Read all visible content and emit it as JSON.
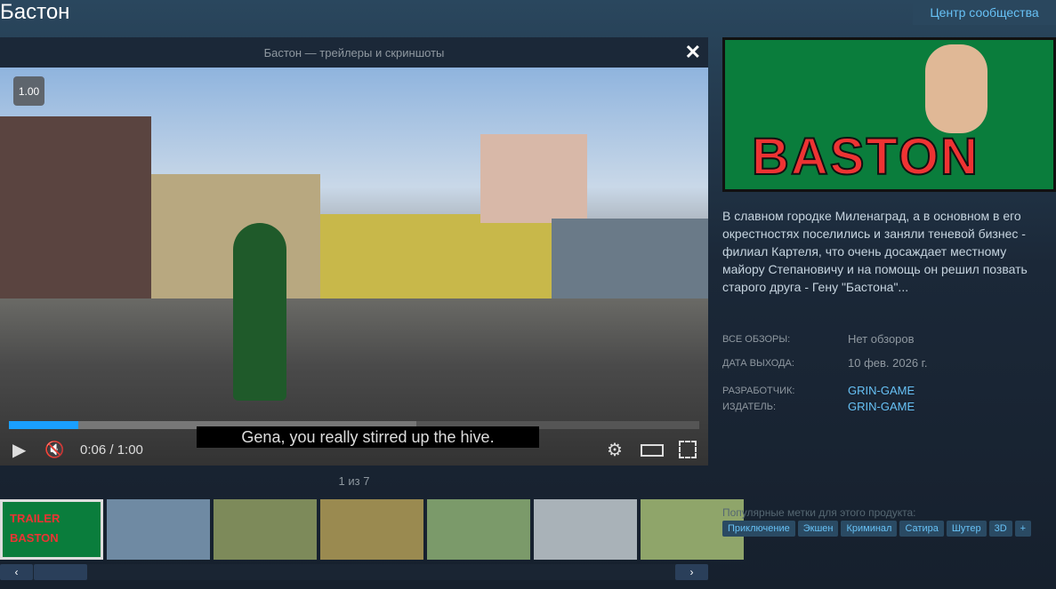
{
  "header": {
    "title": "Бастон",
    "community_button": "Центр сообщества"
  },
  "player": {
    "title": "Бастон — трейлеры и скриншоты",
    "speed": "1.00",
    "subtitle": "Gena, you really stirred up the hive.",
    "time": "0:06 / 1:00",
    "progress_percent": 10,
    "buffered_percent": 59,
    "counter": "1 из 7"
  },
  "capsule": {
    "logo_text": "BASTON"
  },
  "thumbs": [
    {
      "label": "TRAILER BASTON",
      "color": "#0a7d3c"
    },
    {
      "color": "#6f8aa3"
    },
    {
      "color": "#7d8a5a"
    },
    {
      "color": "#9a8a50"
    },
    {
      "color": "#7b9a6a"
    },
    {
      "color": "#a9b2b8"
    },
    {
      "color": "#8fa56a"
    }
  ],
  "description": "В славном городке Миленаград, а в основном в его окрестностях поселились и заняли теневой бизнес - филиал Картеля, что очень досаждает местному майору Степановичу и на помощь он решил позвать старого друга - Гену \"Бастона\"...",
  "info": {
    "reviews_label": "ВСЕ ОБЗОРЫ:",
    "reviews_value": "Нет обзоров",
    "release_label": "ДАТА ВЫХОДА:",
    "release_value": "10 фев. 2026 г.",
    "developer_label": "РАЗРАБОТЧИК:",
    "developer_value": "GRIN-GAME",
    "publisher_label": "ИЗДАТЕЛЬ:",
    "publisher_value": "GRIN-GAME"
  },
  "tags": {
    "label": "Популярные метки для этого продукта:",
    "items": [
      "Приключение",
      "Экшен",
      "Криминал",
      "Сатира",
      "Шутер",
      "3D",
      "+"
    ]
  }
}
